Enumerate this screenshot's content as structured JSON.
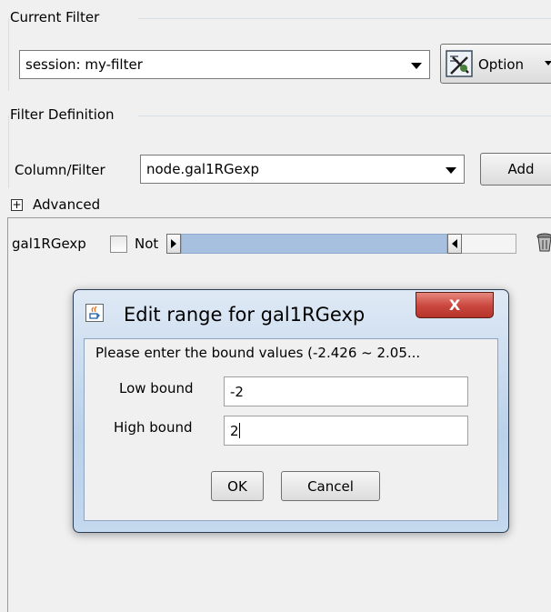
{
  "current_filter": {
    "section_label": "Current Filter",
    "selected": "session: my-filter",
    "option_button": "Option"
  },
  "filter_definition": {
    "section_label": "Filter Definition",
    "column_label": "Column/Filter",
    "column_selected": "node.gal1RGexp",
    "add_button": "Add",
    "advanced_toggle": "+",
    "advanced_label": "Advanced"
  },
  "filter_row": {
    "attribute": "gal1RGexp",
    "not_label": "Not",
    "not_checked": false
  },
  "dialog": {
    "title": "Edit range for gal1RGexp",
    "prompt": "Please enter the bound values (-2.426 ~ 2.05...",
    "low_label": "Low bound",
    "low_value": "-2",
    "high_label": "High bound",
    "high_value": "2",
    "ok_button": "OK",
    "cancel_button": "Cancel",
    "close_button": "X"
  },
  "colors": {
    "slider_fill": "#a7c0e0",
    "close_button_red": "#c9463d",
    "dialog_frame": "#b9d1ea"
  }
}
